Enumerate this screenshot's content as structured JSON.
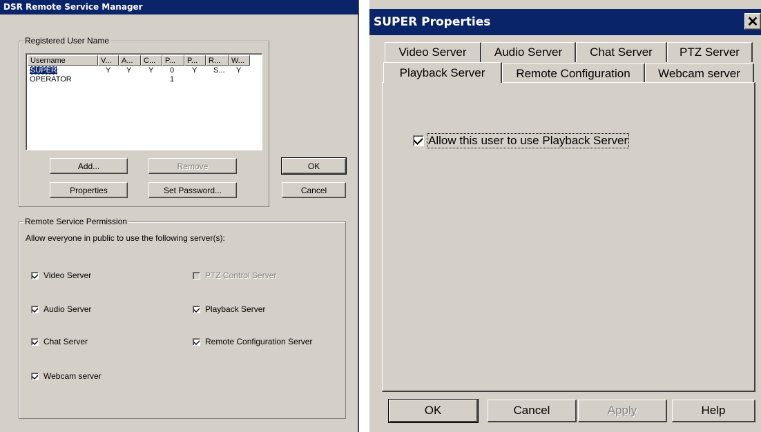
{
  "left_window": {
    "title": "DSR Remote Service Manager",
    "registered_group": {
      "label": "Registered User Name",
      "columns": [
        "Username",
        "V...",
        "A...",
        "C...",
        "P...",
        "P...",
        "R...",
        "W..."
      ],
      "rows": [
        {
          "username": "SUPER",
          "cells": [
            "Y",
            "Y",
            "Y",
            "0",
            "Y",
            "S...",
            "Y"
          ],
          "selected": true
        },
        {
          "username": "OPERATOR",
          "cells": [
            "",
            "",
            "",
            "1",
            "",
            "",
            ""
          ],
          "selected": false
        }
      ],
      "buttons": {
        "add": "Add...",
        "remove": "Remove",
        "properties": "Properties",
        "set_password": "Set Password..."
      }
    },
    "ok_label": "OK",
    "cancel_label": "Cancel",
    "permission_group": {
      "label": "Remote Service Permission",
      "description": "Allow everyone in public to use the following server(s):",
      "options": {
        "video": {
          "label": "Video Server",
          "checked": true,
          "enabled": true
        },
        "audio": {
          "label": "Audio Server",
          "checked": true,
          "enabled": true
        },
        "chat": {
          "label": "Chat Server",
          "checked": true,
          "enabled": true
        },
        "webcam": {
          "label": "Webcam server",
          "checked": true,
          "enabled": true
        },
        "ptz": {
          "label": "PTZ Control Server",
          "checked": false,
          "enabled": false
        },
        "playback": {
          "label": "Playback Server",
          "checked": true,
          "enabled": true
        },
        "remote_config": {
          "label": "Remote Configuration Server",
          "checked": true,
          "enabled": true
        }
      }
    }
  },
  "right_window": {
    "title": "SUPER Properties",
    "close_icon": "close-icon",
    "tabs_row1": [
      "Video Server",
      "Audio Server",
      "Chat Server",
      "PTZ Server"
    ],
    "tabs_row2": [
      "Playback Server",
      "Remote Configuration",
      "Webcam server"
    ],
    "active_tab": "Playback Server",
    "playback_option": {
      "label": "Allow this user to use Playback Server",
      "checked": true
    },
    "buttons": {
      "ok": "OK",
      "cancel": "Cancel",
      "apply": "Apply",
      "help": "Help"
    }
  }
}
